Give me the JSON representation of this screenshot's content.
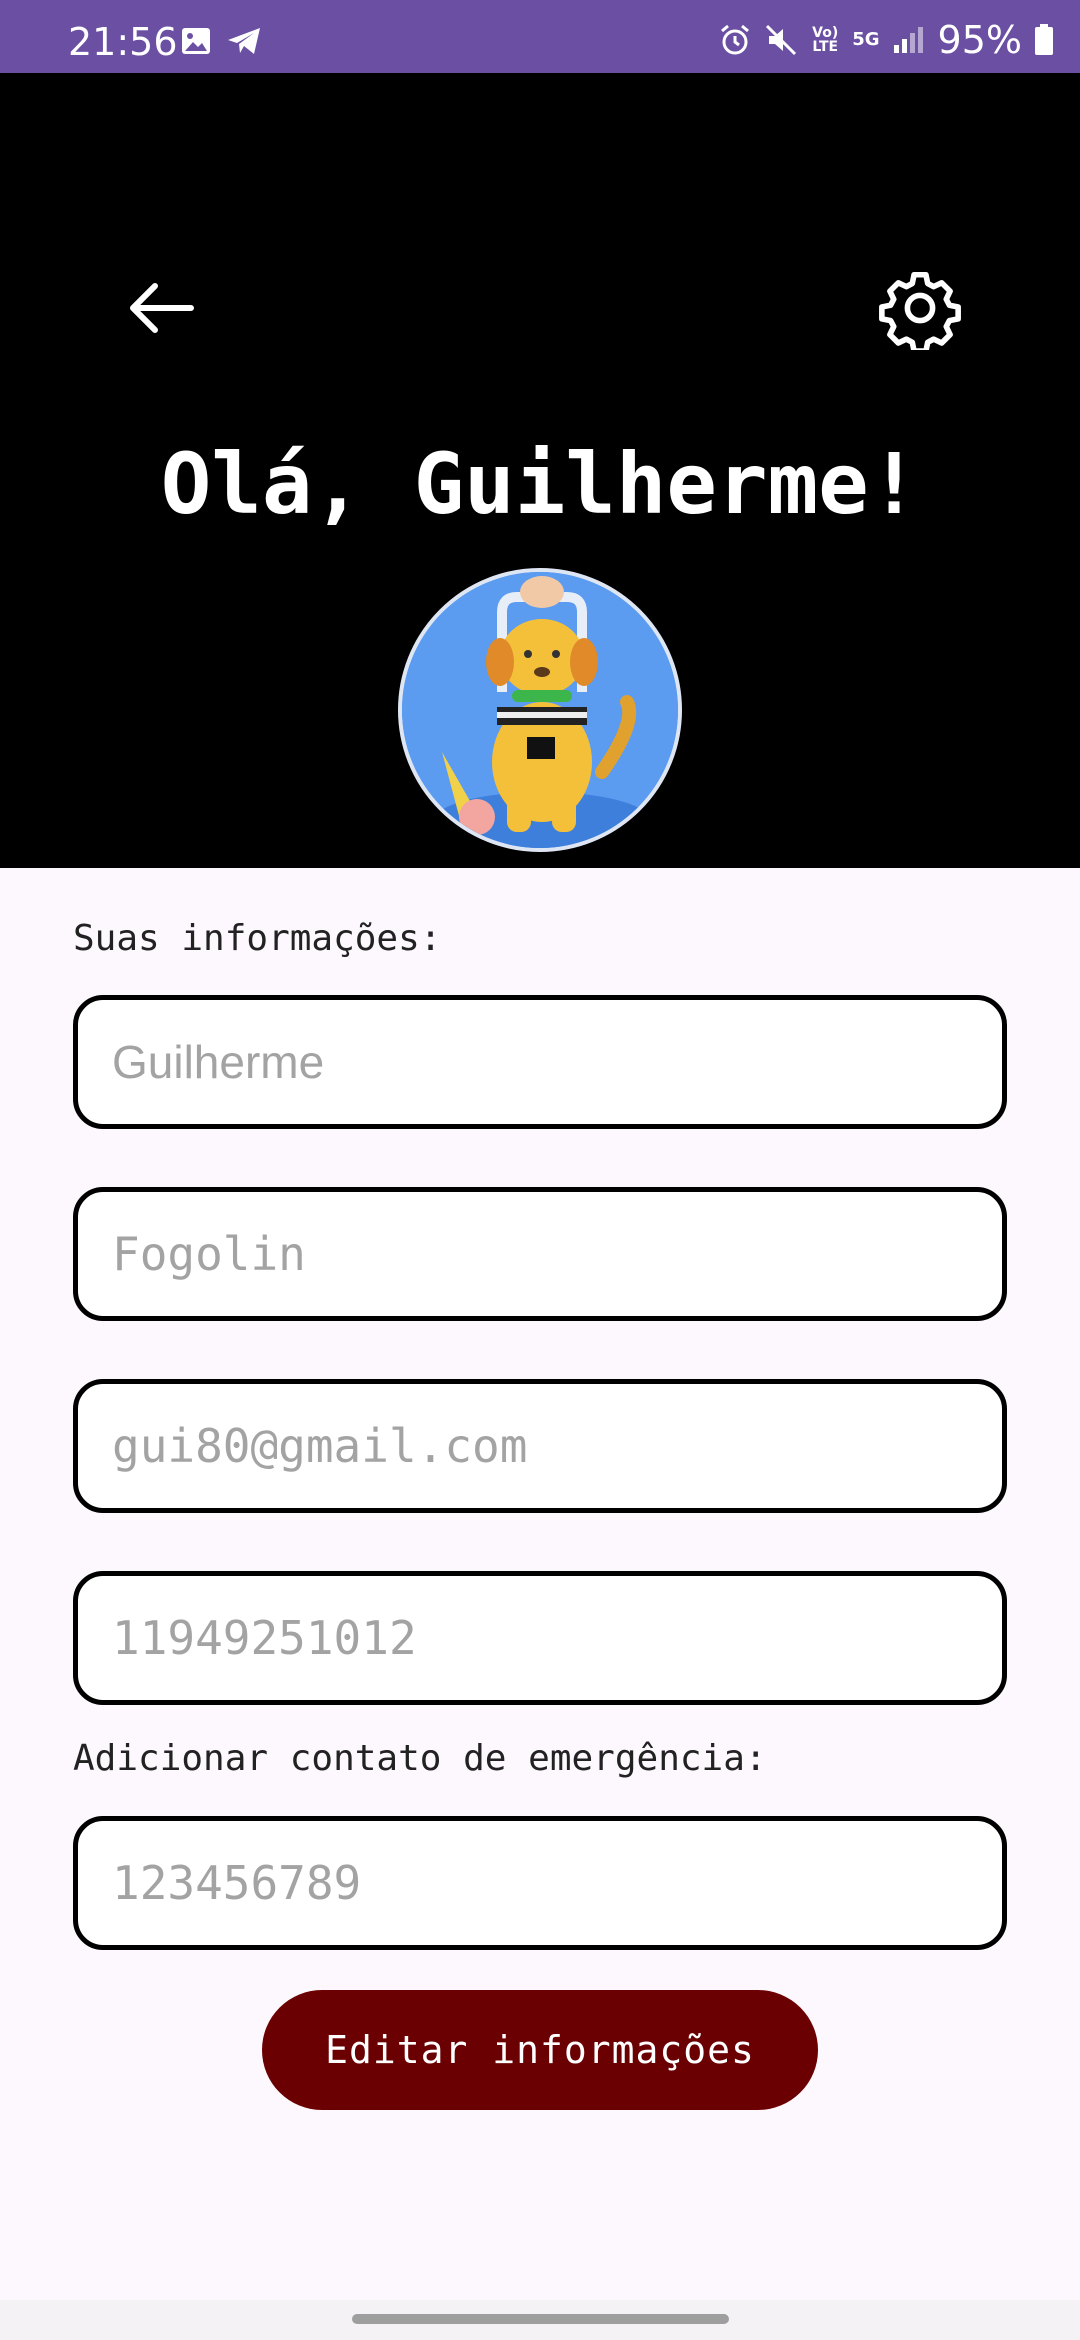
{
  "status_bar": {
    "time": "21:56",
    "battery": "95%",
    "network_label": "5G",
    "volte_label": "Vo) LTE",
    "icons": [
      "image-icon",
      "telegram-icon",
      "alarm-icon",
      "mute-icon",
      "signal-icon",
      "battery-icon"
    ]
  },
  "header": {
    "greeting": "Olá, Guilherme!",
    "back_icon": "arrow-left-icon",
    "settings_icon": "gear-icon"
  },
  "info": {
    "label": "Suas informações:",
    "first_name_placeholder": "Guilherme",
    "last_name_placeholder": "Fogolin",
    "email_placeholder": "gui80@gmail.com",
    "phone_placeholder": "11949251012"
  },
  "emergency": {
    "label": "Adicionar contato de emergência:",
    "contact_placeholder": "123456789"
  },
  "actions": {
    "edit_label": "Editar informações"
  },
  "colors": {
    "status_bar": "#6a4fa3",
    "header_bg": "#000000",
    "button_bg": "#6a0001",
    "page_bg": "#fdf8fd"
  }
}
